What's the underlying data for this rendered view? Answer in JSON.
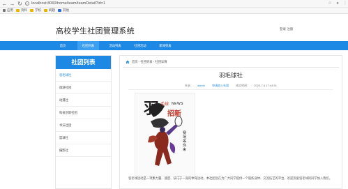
{
  "browser": {
    "url": "localhost:8060/home/team/teamDetail?id=1",
    "bookmarks_label": "应用",
    "bookmarks": [
      "资料",
      "学校",
      "刷题",
      "其他"
    ],
    "bookmark_colors": [
      "#f2b200",
      "#f2b200",
      "#f2b200",
      "#2a6fdb"
    ]
  },
  "header": {
    "site_title": "高校学生社团管理系统",
    "auth_links": "登录 注册"
  },
  "nav": {
    "items": [
      "首页",
      "社团列表",
      "活动列表",
      "社团活动",
      "新闻列表"
    ],
    "active_index": 1
  },
  "sidebar": {
    "title": "社团列表",
    "items": [
      "羽毛球社",
      "旅游社团",
      "动漫社",
      "科技创新社团",
      "书法社团",
      "篮球社",
      "摄影社"
    ],
    "active_index": 0
  },
  "breadcrumb": {
    "text": "首页 - 社团列表 - 社团详情"
  },
  "detail": {
    "title": "羽毛球社",
    "author_label": "社长：",
    "author": "admin",
    "fav_label": "申请加入社团",
    "date_label": "成立时间：",
    "date": "2020-7-6 17:44:51",
    "description": "羽毛球运动是一项集力量、速度、技巧于一身的体育运动，本社团旨在为广大同学提供一个锻炼身体、交流技艺的平台，欢迎热爱羽毛球的同学加入我们。"
  },
  "poster": {
    "big_text": "羽",
    "sub_text": "毛球",
    "news": "NEWS",
    "side_text": "招新",
    "bottom_text": "赛场等你来"
  },
  "colors": {
    "primary": "#1e88e5",
    "active_nav": "#3d9ff0"
  }
}
